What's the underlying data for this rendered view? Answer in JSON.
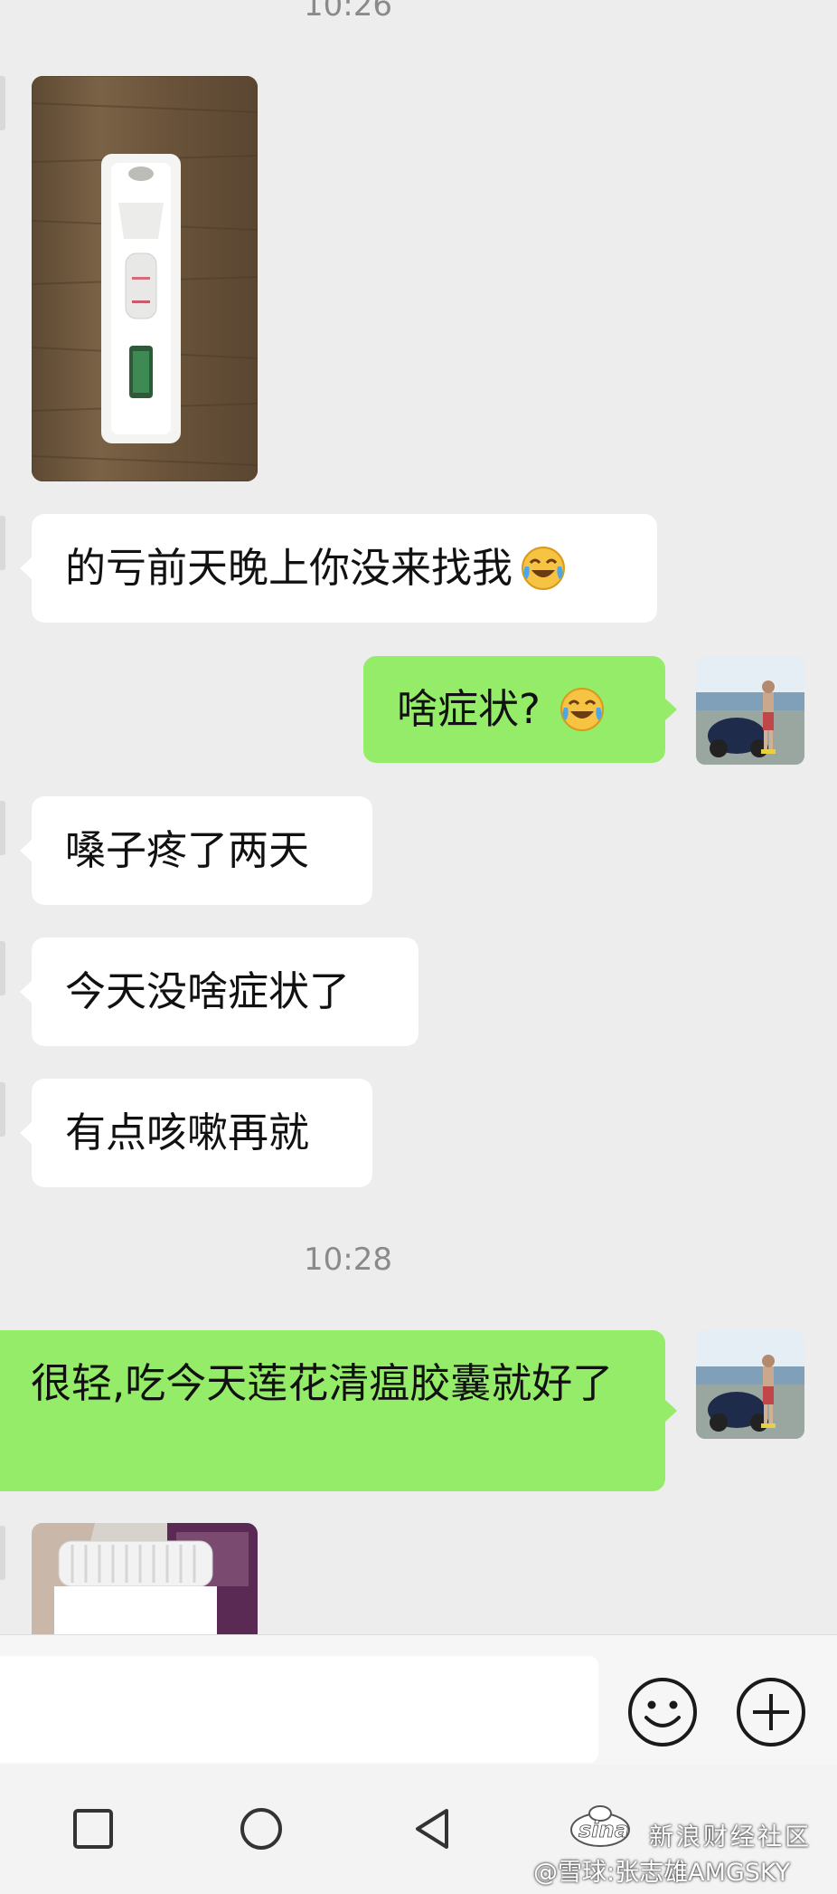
{
  "timestamps": [
    "10:26",
    "10:28"
  ],
  "messages": [
    {
      "side": "in",
      "type": "image",
      "depicts": "pregnancy-style rapid test cassette on wooden table"
    },
    {
      "side": "in",
      "type": "text",
      "text": "的亏前天晚上你没来找我",
      "emoji": "face-with-tears-of-joy"
    },
    {
      "side": "out",
      "type": "text",
      "text": "啥症状?",
      "emoji": "face-with-tears-of-joy"
    },
    {
      "side": "in",
      "type": "text",
      "text": "嗓子疼了两天"
    },
    {
      "side": "in",
      "type": "text",
      "text": "今天没啥症状了"
    },
    {
      "side": "in",
      "type": "text",
      "text": "有点咳嗽再就"
    },
    {
      "side": "out",
      "type": "text",
      "text": "很轻,吃今天莲花清瘟胶囊就好了"
    },
    {
      "side": "in",
      "type": "image",
      "depicts": "medicine bottle"
    }
  ],
  "composer": {
    "input_value": "",
    "emoji_button": "emoji-icon",
    "more_button": "plus-icon"
  },
  "navigation": {
    "recent": "square-icon",
    "home": "circle-icon",
    "back": "triangle-back-icon"
  },
  "watermark": {
    "brand": "sina",
    "line1": "新浪财经社区",
    "line2": "@雪球:张志雄AMGSKY"
  },
  "colors": {
    "background": "#ededed",
    "incoming_bubble": "#ffffff",
    "outgoing_bubble": "#95ec69",
    "timestamp": "#8a8a8a"
  }
}
